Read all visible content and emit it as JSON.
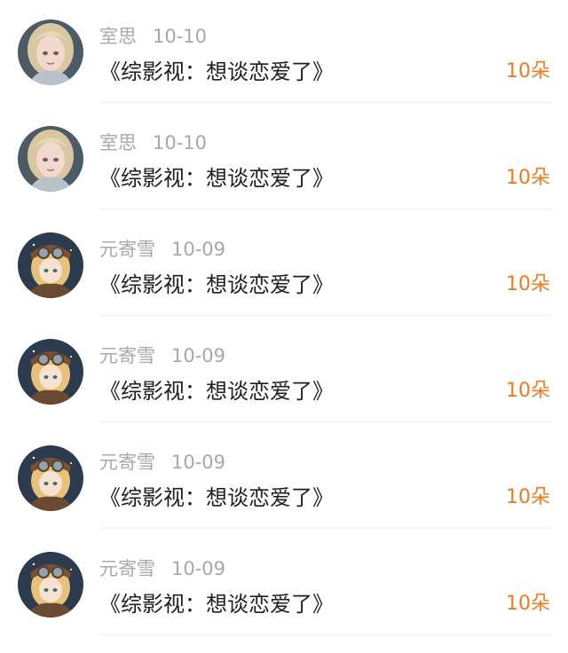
{
  "rows": [
    {
      "name": "室思",
      "date": "10-10",
      "title": "《综影视：想谈恋爱了》",
      "count": "10朵",
      "avatar": "blonde-girl-avatar"
    },
    {
      "name": "室思",
      "date": "10-10",
      "title": "《综影视：想谈恋爱了》",
      "count": "10朵",
      "avatar": "blonde-girl-avatar"
    },
    {
      "name": "元寄雪",
      "date": "10-09",
      "title": "《综影视：想谈恋爱了》",
      "count": "10朵",
      "avatar": "goggles-girl-avatar"
    },
    {
      "name": "元寄雪",
      "date": "10-09",
      "title": "《综影视：想谈恋爱了》",
      "count": "10朵",
      "avatar": "goggles-girl-avatar"
    },
    {
      "name": "元寄雪",
      "date": "10-09",
      "title": "《综影视：想谈恋爱了》",
      "count": "10朵",
      "avatar": "goggles-girl-avatar"
    },
    {
      "name": "元寄雪",
      "date": "10-09",
      "title": "《综影视：想谈恋爱了》",
      "count": "10朵",
      "avatar": "goggles-girl-avatar"
    }
  ],
  "colors": {
    "username": "#a8a8a8",
    "title": "#1f1f1f",
    "count_accent": "#f27a1e",
    "divider": "#ededed"
  }
}
